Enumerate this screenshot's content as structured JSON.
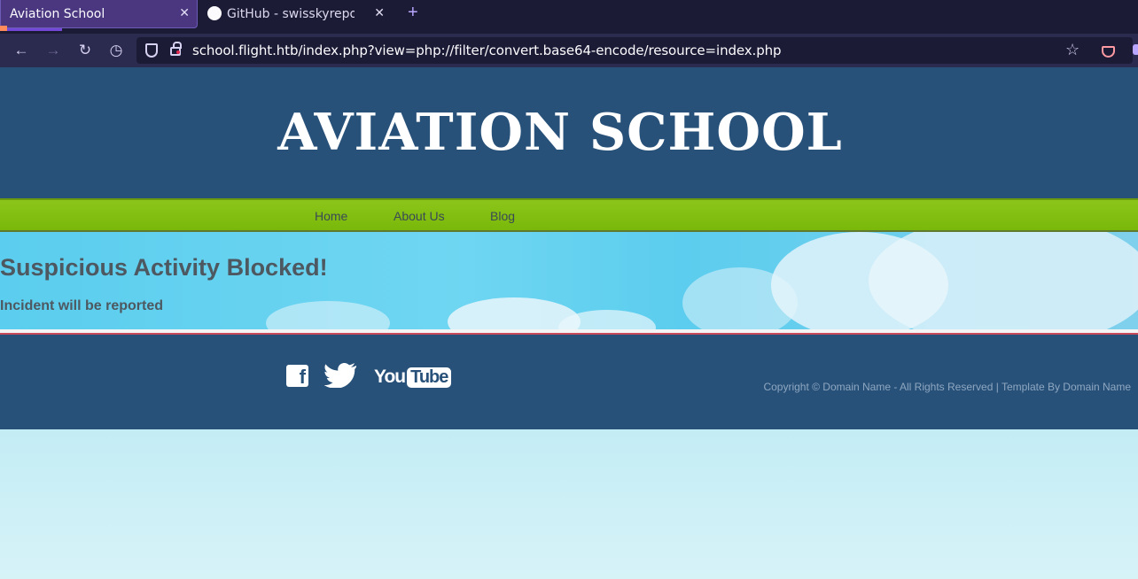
{
  "browser": {
    "tabs": [
      {
        "title": "Aviation School",
        "active": true
      },
      {
        "title": "GitHub - swisskyrepo/Pay",
        "active": false
      }
    ],
    "url": "school.flight.htb/index.php?view=php://filter/convert.base64-encode/resource=index.php",
    "icons": {
      "back": "arrow-left-icon",
      "forward": "arrow-right-icon",
      "reload": "reload-icon",
      "history": "clock-icon",
      "shield": "shield-icon",
      "lock": "lock-icon",
      "star": "star-icon",
      "pocket": "pocket-icon"
    },
    "colors": {
      "tabbar": "#1c1b36",
      "navbar": "#2b2a4f",
      "active_tab": "#4a3780"
    }
  },
  "site": {
    "title": "AVIATION SCHOOL",
    "menu": [
      "Home",
      "About Us",
      "Blog"
    ],
    "message": {
      "heading": "Suspicious Activity Blocked!",
      "subheading": "Incident will be reported"
    },
    "footer": {
      "social": [
        "facebook-icon",
        "twitter-icon",
        "youtube-icon"
      ],
      "youtube_text": [
        "You",
        "Tube"
      ],
      "copyright": "Copyright © Domain Name - All Rights Reserved | Template By Domain Name"
    },
    "colors": {
      "header": "#28517a",
      "menu": "#80bf10",
      "text": "#4d5860",
      "banner": "#5bcdee"
    }
  }
}
